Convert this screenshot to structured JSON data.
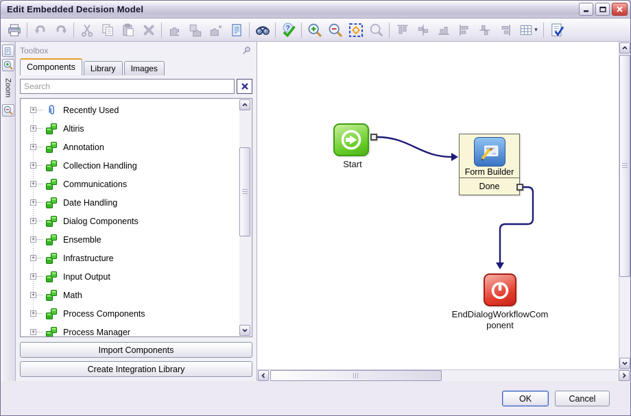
{
  "window": {
    "title": "Edit Embedded Decision Model",
    "controls": [
      {
        "icon": "minimize-icon",
        "name": "minimize-button"
      },
      {
        "icon": "maximize-icon",
        "name": "maximize-button"
      },
      {
        "icon": "close-icon",
        "name": "close-button"
      }
    ]
  },
  "toolbar": {
    "items": [
      {
        "icon": "print-icon",
        "enabled": true
      },
      {
        "icon": "separator"
      },
      {
        "icon": "undo-icon",
        "enabled": false
      },
      {
        "icon": "redo-icon",
        "enabled": false
      },
      {
        "icon": "separator"
      },
      {
        "icon": "cut-icon",
        "enabled": false
      },
      {
        "icon": "copy-icon",
        "enabled": false
      },
      {
        "icon": "paste-icon",
        "enabled": false
      },
      {
        "icon": "delete-icon",
        "enabled": false
      },
      {
        "icon": "separator"
      },
      {
        "icon": "component-puzzle-icon",
        "enabled": false
      },
      {
        "icon": "component-copy-icon",
        "enabled": false
      },
      {
        "icon": "component-new-icon",
        "enabled": false
      },
      {
        "icon": "report-icon",
        "enabled": true
      },
      {
        "icon": "separator"
      },
      {
        "icon": "find-icon",
        "enabled": true
      },
      {
        "icon": "separator"
      },
      {
        "icon": "validate-icon",
        "enabled": true
      },
      {
        "icon": "separator"
      },
      {
        "icon": "zoom-in-icon",
        "enabled": true
      },
      {
        "icon": "zoom-out-icon",
        "enabled": true
      },
      {
        "icon": "zoom-fit-icon",
        "enabled": true
      },
      {
        "icon": "zoom-tool-icon",
        "enabled": false
      },
      {
        "icon": "separator"
      },
      {
        "icon": "align-top-icon",
        "enabled": false
      },
      {
        "icon": "align-middle-icon",
        "enabled": false
      },
      {
        "icon": "align-bottom-icon",
        "enabled": false
      },
      {
        "icon": "align-left-icon",
        "enabled": false
      },
      {
        "icon": "align-center-icon",
        "enabled": false
      },
      {
        "icon": "align-right-icon",
        "enabled": false
      },
      {
        "icon": "grid-icon",
        "enabled": true,
        "dropdown": true
      },
      {
        "icon": "separator"
      },
      {
        "icon": "check-model-icon",
        "enabled": true
      }
    ]
  },
  "zoom_strip": {
    "label": "Zoom",
    "icons": [
      "page-icon",
      "zoom-in-icon",
      "zoom-out-icon"
    ]
  },
  "toolbox": {
    "header": "Toolbox",
    "pin_icon": "pin-icon",
    "tabs": [
      {
        "label": "Components",
        "active": true
      },
      {
        "label": "Library",
        "active": false
      },
      {
        "label": "Images",
        "active": false
      }
    ],
    "search": {
      "placeholder": "Search",
      "clear_icon": "close-x-icon"
    },
    "tree": [
      {
        "icon": "paperclip-icon",
        "label": "Recently Used"
      },
      {
        "icon": "puzzle-icon",
        "label": "Altiris"
      },
      {
        "icon": "puzzle-icon",
        "label": "Annotation"
      },
      {
        "icon": "puzzle-icon",
        "label": "Collection Handling"
      },
      {
        "icon": "puzzle-icon",
        "label": "Communications"
      },
      {
        "icon": "puzzle-icon",
        "label": "Date Handling"
      },
      {
        "icon": "puzzle-icon",
        "label": "Dialog Components"
      },
      {
        "icon": "puzzle-icon",
        "label": "Ensemble"
      },
      {
        "icon": "puzzle-icon",
        "label": "Infrastructure"
      },
      {
        "icon": "puzzle-icon",
        "label": "Input Output"
      },
      {
        "icon": "puzzle-icon",
        "label": "Math"
      },
      {
        "icon": "puzzle-icon",
        "label": "Process Components"
      },
      {
        "icon": "puzzle-icon",
        "label": "Process Manager"
      },
      {
        "icon": "puzzle-icon",
        "label": ""
      }
    ],
    "buttons": [
      {
        "label": "Import Components"
      },
      {
        "label": "Create Integration Library"
      }
    ]
  },
  "canvas": {
    "nodes": {
      "start": {
        "label": "Start",
        "icon": "start-arrow-icon"
      },
      "form_builder": {
        "title": "Form Builder",
        "output_port": "Done",
        "icon": "form-edit-icon"
      },
      "end": {
        "name": "EndDialogWorkflowComponent",
        "label_lines": [
          "EndDialogWorkflowCom",
          "ponent"
        ],
        "icon": "power-off-icon"
      }
    },
    "connections": [
      {
        "from": "Start",
        "to": "Form Builder"
      },
      {
        "from": "Form Builder.Done",
        "to": "EndDialogWorkflowComponent"
      }
    ],
    "colors": {
      "connector": "#1b1b78",
      "node_fill": "#f9f5d7",
      "start_green": "#54c41e",
      "end_red": "#e03028"
    }
  },
  "footer": {
    "ok_label": "OK",
    "cancel_label": "Cancel"
  }
}
